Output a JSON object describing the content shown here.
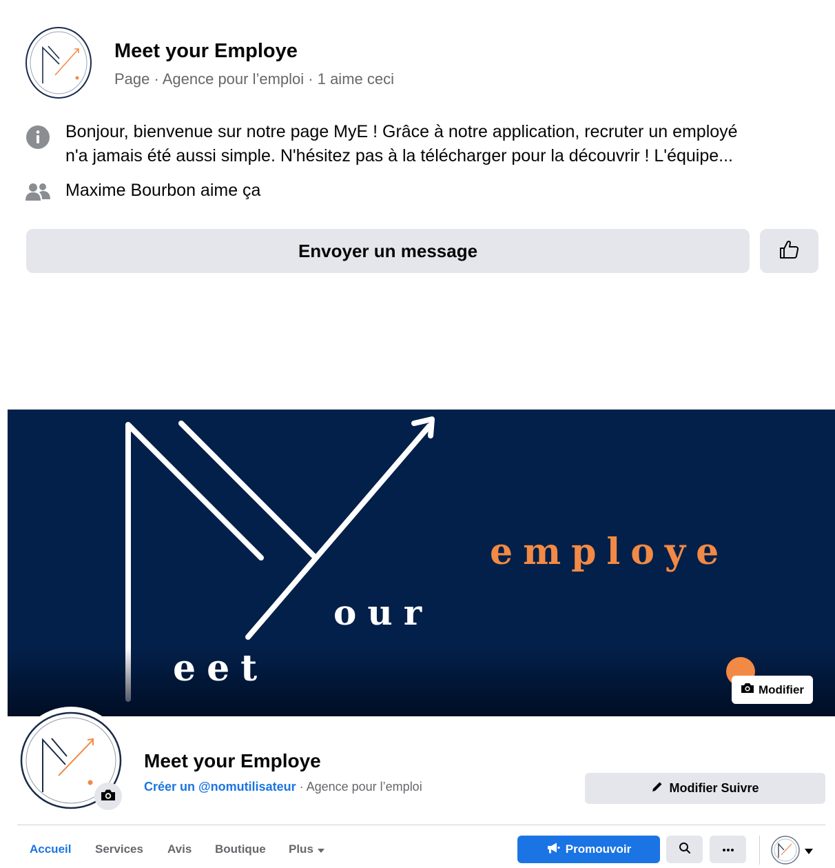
{
  "card": {
    "title": "Meet your Employe",
    "subtitle": "Page · Agence pour l’emploi · 1 aime ceci",
    "intro_line1": "Bonjour, bienvenue sur notre page MyE ! Grâce à notre application, recruter un employé",
    "intro_line2": "n'a jamais été aussi simple. N'hésitez pas à la télécharger pour la découvrir ! L'équipe...",
    "likes_text": "Maxime Bourbon aime ça",
    "message_button": "Envoyer un message",
    "icons": {
      "info": "info-icon",
      "friends": "friends-icon",
      "like": "thumbs-up-icon"
    }
  },
  "cover": {
    "word_top": "employe",
    "word_middle": "our",
    "word_bottom": "eet",
    "edit_button": "Modifier",
    "colors": {
      "background": "#03204a",
      "accent": "#f28a45"
    }
  },
  "profile": {
    "name": "Meet your Employe",
    "username_link": "Créer un @nomutilisateur",
    "category": " · Agence pour l’emploi",
    "edit_follow_button": "Modifier Suivre"
  },
  "nav": {
    "tabs": [
      "Accueil",
      "Services",
      "Avis",
      "Boutique",
      "Plus"
    ],
    "active_tab": "Accueil",
    "promote_button": "Promouvoir",
    "icons": {
      "search": "search-icon",
      "more": "more-icon",
      "switch": "profile-switcher"
    }
  },
  "colors": {
    "primary": "#1b74e4",
    "secondary_text": "#65676b",
    "button_grey": "#e4e6eb"
  }
}
